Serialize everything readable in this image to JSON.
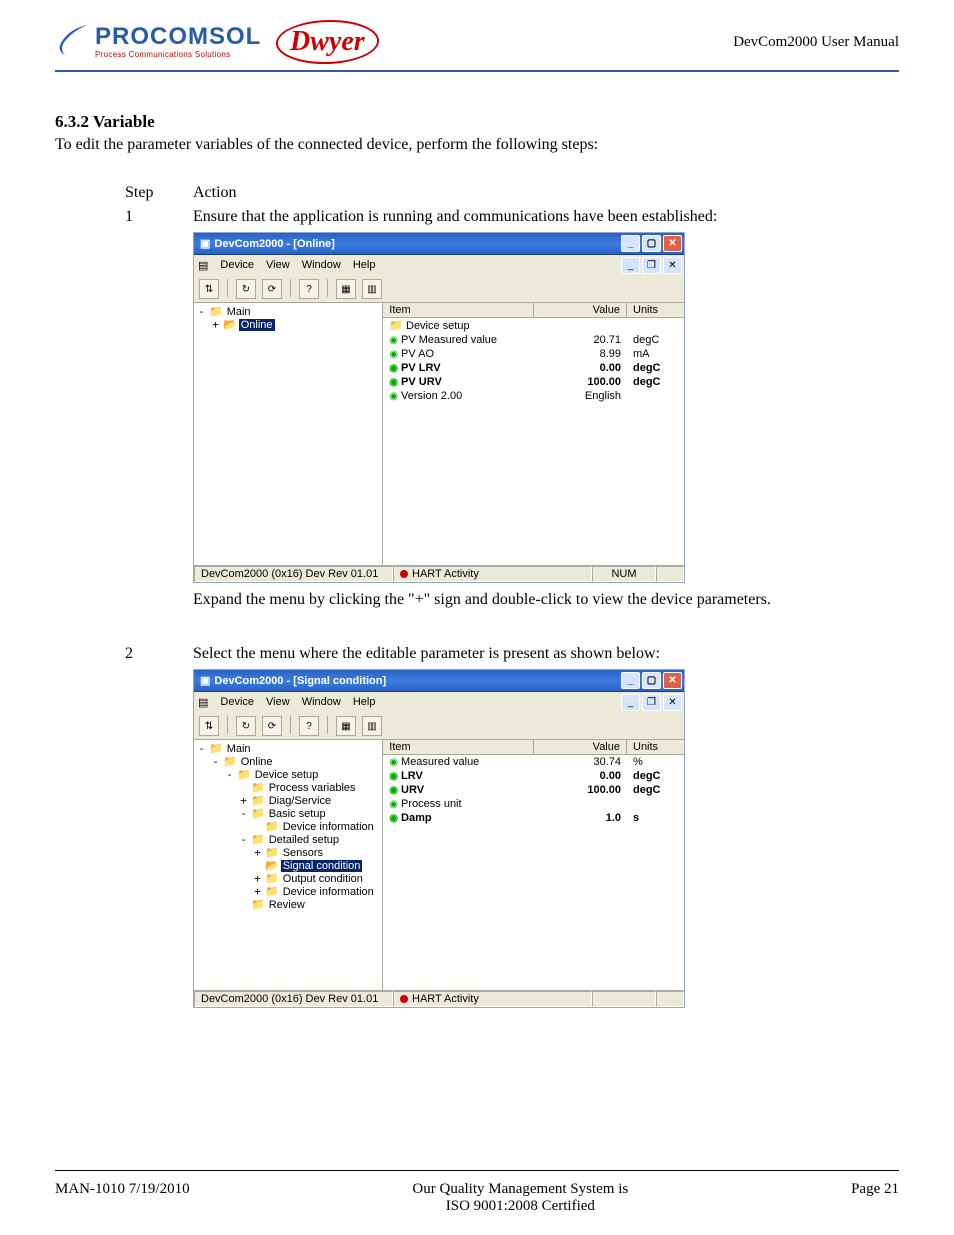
{
  "header": {
    "logo": {
      "name": "PROCOMSOL",
      "tagline": "Process Communications Solutions"
    },
    "partner_logo": "Dwyer",
    "manual_title": "DevCom2000 User Manual"
  },
  "section": {
    "number_title": "6.3.2   Variable",
    "intro": "To edit the parameter variables of the connected device, perform the following steps:",
    "col_step": "Step",
    "col_action": "Action"
  },
  "steps": [
    {
      "num": "1",
      "text_before": "Ensure that the application is running and communications have been established:",
      "text_after": "Expand the menu by clicking the \"+\" sign and double-click to view the device parameters."
    },
    {
      "num": "2",
      "text_before": "Select the menu where the editable parameter is present as shown below:",
      "text_after": ""
    }
  ],
  "shot1": {
    "title": "DevCom2000 - [Online]",
    "menus": [
      "Device",
      "View",
      "Window",
      "Help"
    ],
    "tree": {
      "root": "Main",
      "branch": "Online"
    },
    "list_header": {
      "item": "Item",
      "value": "Value",
      "units": "Units"
    },
    "rows": [
      {
        "item": "Device setup",
        "value": "",
        "units": "",
        "icon": "folder",
        "bold": false
      },
      {
        "item": "PV Measured value",
        "value": "20.71",
        "units": "degC",
        "icon": "var",
        "bold": false
      },
      {
        "item": "PV AO",
        "value": "8.99",
        "units": "mA",
        "icon": "var",
        "bold": false
      },
      {
        "item": "PV LRV",
        "value": "0.00",
        "units": "degC",
        "icon": "var",
        "bold": true
      },
      {
        "item": "PV URV",
        "value": "100.00",
        "units": "degC",
        "icon": "var",
        "bold": true
      },
      {
        "item": "Version 2.00",
        "value": "English",
        "units": "",
        "icon": "var",
        "bold": false
      }
    ],
    "status": {
      "left": "DevCom2000   (0x16)  Dev Rev 01.01",
      "mid": "HART Activity",
      "num": "NUM"
    }
  },
  "shot2": {
    "title": "DevCom2000 - [Signal condition]",
    "menus": [
      "Device",
      "View",
      "Window",
      "Help"
    ],
    "tree": [
      {
        "lvl": 0,
        "exp": "-",
        "label": "Main",
        "sel": false
      },
      {
        "lvl": 1,
        "exp": "-",
        "label": "Online",
        "sel": false
      },
      {
        "lvl": 2,
        "exp": "-",
        "label": "Device setup",
        "sel": false
      },
      {
        "lvl": 3,
        "exp": "",
        "label": "Process variables",
        "sel": false
      },
      {
        "lvl": 3,
        "exp": "+",
        "label": "Diag/Service",
        "sel": false
      },
      {
        "lvl": 3,
        "exp": "-",
        "label": "Basic setup",
        "sel": false
      },
      {
        "lvl": 4,
        "exp": "",
        "label": "Device information",
        "sel": false
      },
      {
        "lvl": 3,
        "exp": "-",
        "label": "Detailed setup",
        "sel": false
      },
      {
        "lvl": 4,
        "exp": "+",
        "label": "Sensors",
        "sel": false
      },
      {
        "lvl": 4,
        "exp": "",
        "label": "Signal condition",
        "sel": true
      },
      {
        "lvl": 4,
        "exp": "+",
        "label": "Output condition",
        "sel": false
      },
      {
        "lvl": 4,
        "exp": "+",
        "label": "Device information",
        "sel": false
      },
      {
        "lvl": 3,
        "exp": "",
        "label": "Review",
        "sel": false
      }
    ],
    "list_header": {
      "item": "Item",
      "value": "Value",
      "units": "Units"
    },
    "rows": [
      {
        "item": "Measured value",
        "value": "30.74",
        "units": "%",
        "bold": false
      },
      {
        "item": "LRV",
        "value": "0.00",
        "units": "degC",
        "bold": true
      },
      {
        "item": "URV",
        "value": "100.00",
        "units": "degC",
        "bold": true
      },
      {
        "item": "Process unit",
        "value": "",
        "units": "",
        "bold": false
      },
      {
        "item": "Damp",
        "value": "1.0",
        "units": "s",
        "bold": true
      }
    ],
    "status": {
      "left": "DevCom2000   (0x16)  Dev Rev 01.01",
      "mid": "HART Activity",
      "num": ""
    }
  },
  "footer": {
    "left": "MAN-1010 7/19/2010",
    "center_line1": "Our Quality Management System is",
    "center_line2": "ISO 9001:2008 Certified",
    "right": "Page 21"
  }
}
